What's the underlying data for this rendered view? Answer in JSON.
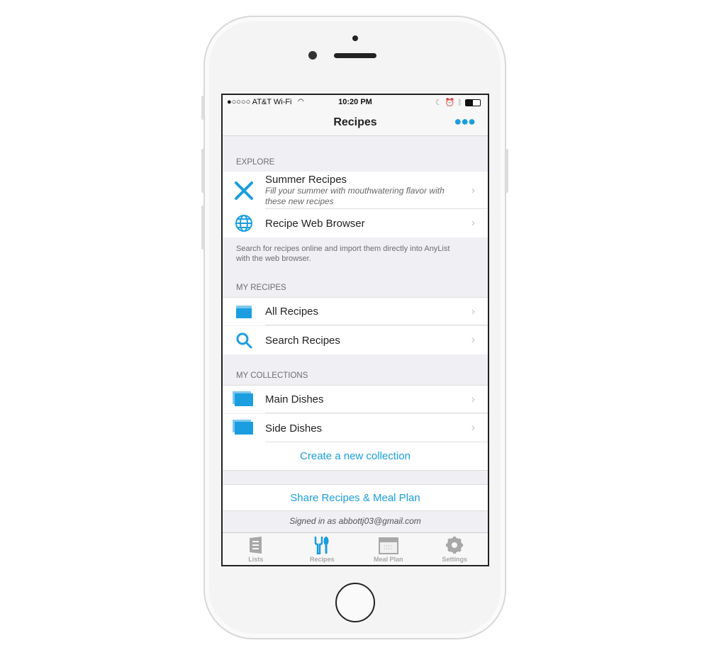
{
  "status": {
    "carrier": "●○○○○ AT&T Wi-Fi",
    "time": "10:20 PM"
  },
  "nav": {
    "title": "Recipes",
    "more_icon": "ellipsis-icon"
  },
  "explore": {
    "header": "EXPLORE",
    "items": [
      {
        "title": "Summer Recipes",
        "subtitle": "Fill your summer with mouthwatering flavor with these new recipes",
        "icon": "fork-knife-icon"
      },
      {
        "title": "Recipe Web Browser",
        "icon": "globe-icon"
      }
    ],
    "footer": "Search for recipes online and import them directly into AnyList with the web browser."
  },
  "my_recipes": {
    "header": "MY RECIPES",
    "items": [
      {
        "title": "All Recipes",
        "icon": "box-icon"
      },
      {
        "title": "Search Recipes",
        "icon": "search-icon"
      }
    ]
  },
  "collections": {
    "header": "MY COLLECTIONS",
    "items": [
      {
        "title": "Main Dishes",
        "icon": "folder-stack-icon"
      },
      {
        "title": "Side Dishes",
        "icon": "folder-stack-icon"
      }
    ],
    "create_label": "Create a new collection"
  },
  "share_label": "Share Recipes & Meal Plan",
  "signed_in": "Signed in as abbottj03@gmail.com",
  "tabs": [
    {
      "label": "Lists"
    },
    {
      "label": "Recipes",
      "active": true
    },
    {
      "label": "Meal Plan"
    },
    {
      "label": "Settings"
    }
  ],
  "accent": "#1a9ee0"
}
